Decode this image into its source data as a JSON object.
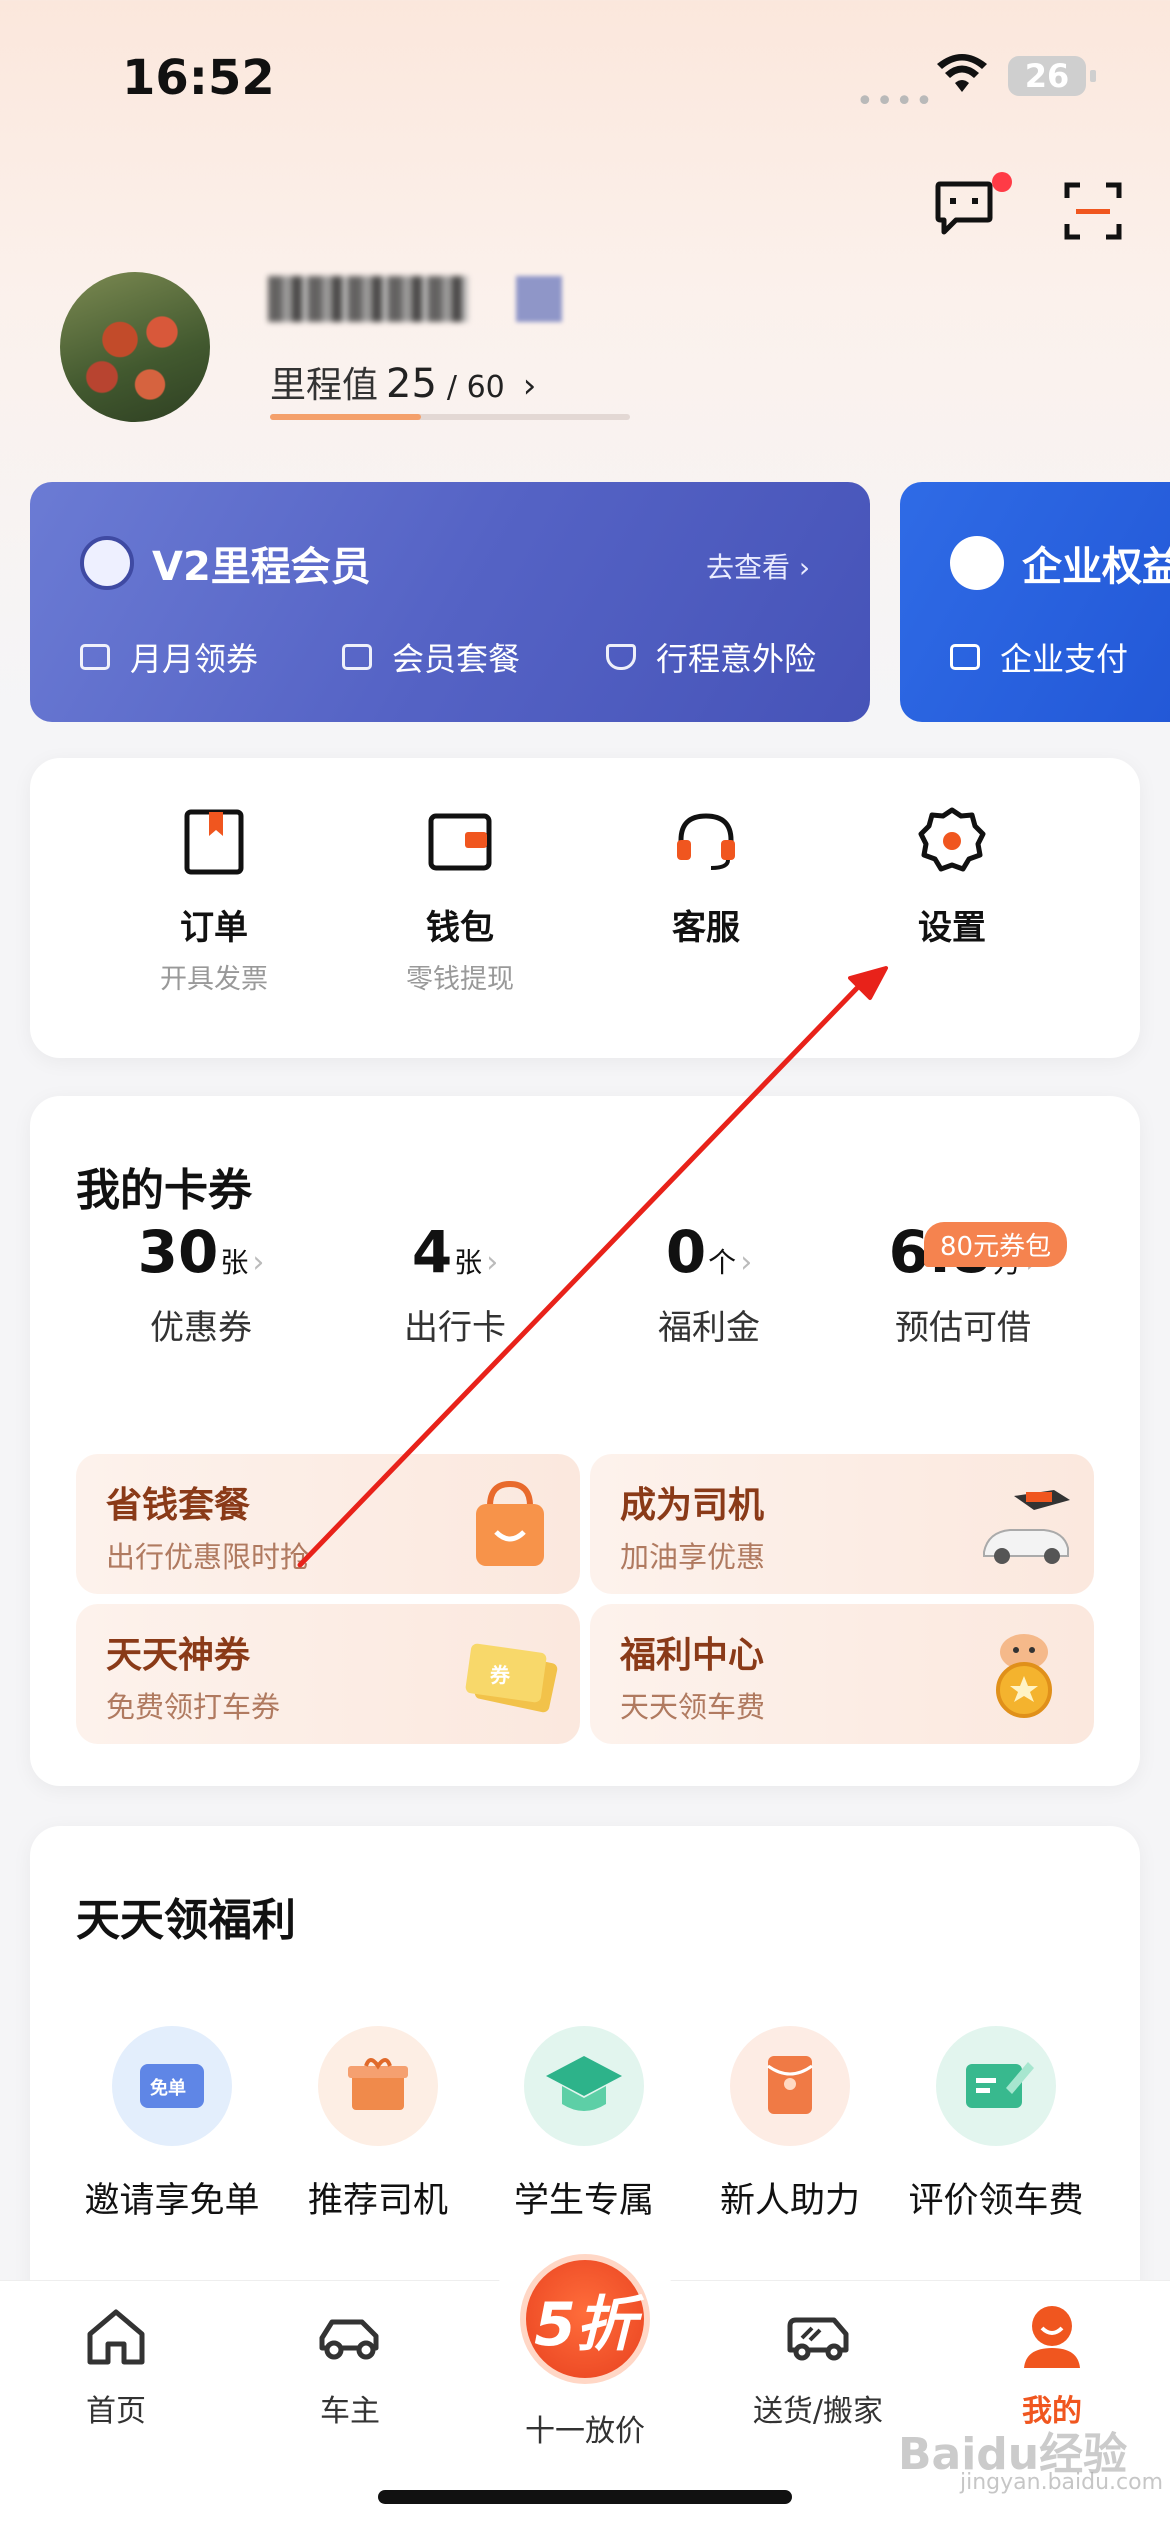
{
  "status_bar": {
    "time": "16:52",
    "battery": "26"
  },
  "profile": {
    "mileage_label": "里程值",
    "mileage_value": "25",
    "mileage_max": "/ 60",
    "mileage_chevron": "›",
    "mileage_progress": 0.42
  },
  "member_card": {
    "title": "V2里程会员",
    "link": "去查看 ›",
    "items": [
      "月月领券",
      "会员套餐",
      "行程意外险"
    ]
  },
  "enterprise_card": {
    "title": "企业权益",
    "item": "企业支付"
  },
  "shortcuts": [
    {
      "label": "订单",
      "sub": "开具发票",
      "icon": "order-icon"
    },
    {
      "label": "钱包",
      "sub": "零钱提现",
      "icon": "wallet-icon"
    },
    {
      "label": "客服",
      "sub": "",
      "icon": "headset-icon"
    },
    {
      "label": "设置",
      "sub": "",
      "icon": "gear-icon"
    }
  ],
  "coupons": {
    "title": "我的卡券",
    "badge": "80元券包",
    "stats": [
      {
        "value": "30",
        "unit": "张",
        "label": "优惠券"
      },
      {
        "value": "4",
        "unit": "张",
        "label": "出行卡"
      },
      {
        "value": "0",
        "unit": "个",
        "label": "福利金"
      },
      {
        "value": "6.8",
        "unit": "万",
        "label": "预估可借"
      }
    ],
    "promos": [
      {
        "title": "省钱套餐",
        "sub": "出行优惠限时抢",
        "icon": "shopping-bag-icon"
      },
      {
        "title": "成为司机",
        "sub": "加油享优惠",
        "icon": "car-fuel-icon"
      },
      {
        "title": "天天神券",
        "sub": "免费领打车券",
        "icon": "ticket-icon"
      },
      {
        "title": "福利中心",
        "sub": "天天领车费",
        "icon": "coin-cat-icon"
      }
    ]
  },
  "welfare": {
    "title": "天天领福利",
    "items": [
      {
        "label": "邀请享免单",
        "icon": "free-ticket-icon",
        "badge": "免单"
      },
      {
        "label": "推荐司机",
        "icon": "gift-icon"
      },
      {
        "label": "学生专属",
        "icon": "graduation-cap-icon"
      },
      {
        "label": "新人助力",
        "icon": "red-envelope-icon"
      },
      {
        "label": "评价领车费",
        "icon": "review-icon"
      }
    ]
  },
  "tabbar": {
    "tabs": [
      {
        "label": "首页",
        "icon": "home-icon"
      },
      {
        "label": "车主",
        "icon": "car-icon"
      },
      {
        "label": "十一放价",
        "icon": "promo-badge-icon",
        "badge": "5折"
      },
      {
        "label": "送货/搬家",
        "icon": "truck-icon"
      },
      {
        "label": "我的",
        "icon": "profile-icon"
      }
    ]
  },
  "watermark": {
    "text": "Baidu经验",
    "sub": "jingyan.baidu.com"
  },
  "colors": {
    "accent": "#f5834f",
    "member_blue": "#5563c5",
    "enterprise_blue": "#2257d6",
    "active_tab": "#f0561f"
  }
}
